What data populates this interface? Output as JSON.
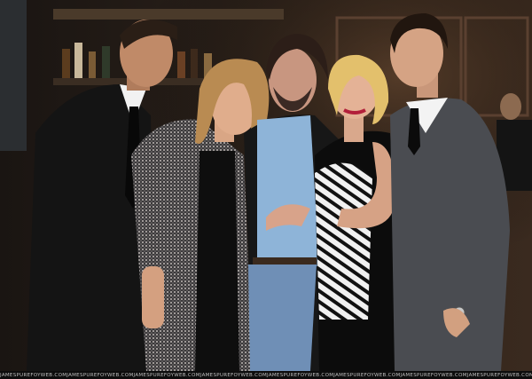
{
  "photo": {
    "watermark_text": "JAMESPUREFOYWEB.COM",
    "watermark_repeats": 9
  }
}
